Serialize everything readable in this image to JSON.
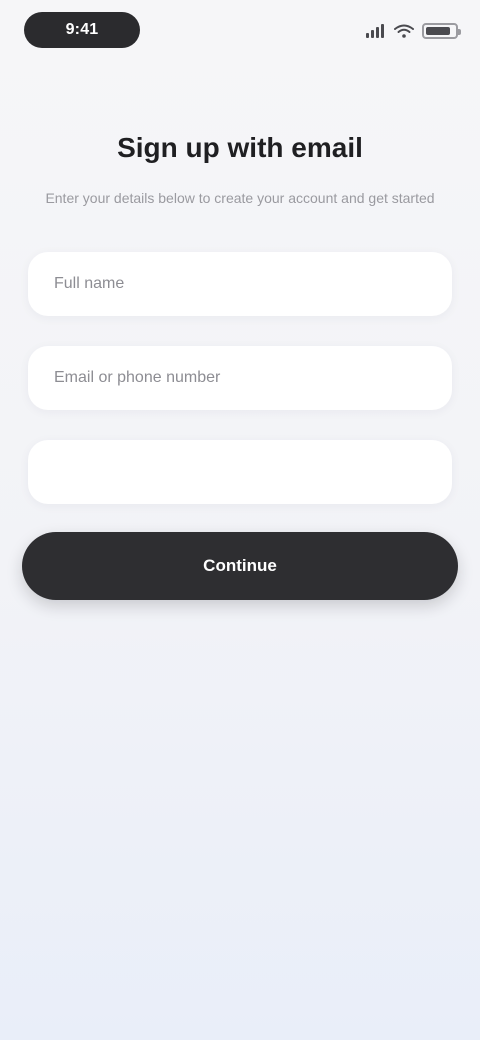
{
  "status_bar": {
    "time": "9:41",
    "icons": [
      "signal-icon",
      "wifi-icon",
      "battery-icon"
    ]
  },
  "header": {
    "title": "Sign up with email",
    "subtitle": "Enter your details below to create your account and get started"
  },
  "form": {
    "fields": [
      {
        "placeholder": "Full name",
        "value": ""
      },
      {
        "placeholder": "Email or phone number",
        "value": ""
      },
      {
        "placeholder": "",
        "value": ""
      }
    ],
    "submit_label": "Continue"
  },
  "colors": {
    "button_bg": "#2e2e31",
    "time_pill_bg": "#2b2b2e",
    "background_top": "#f6f6f8",
    "background_bottom": "#e9eef9"
  }
}
